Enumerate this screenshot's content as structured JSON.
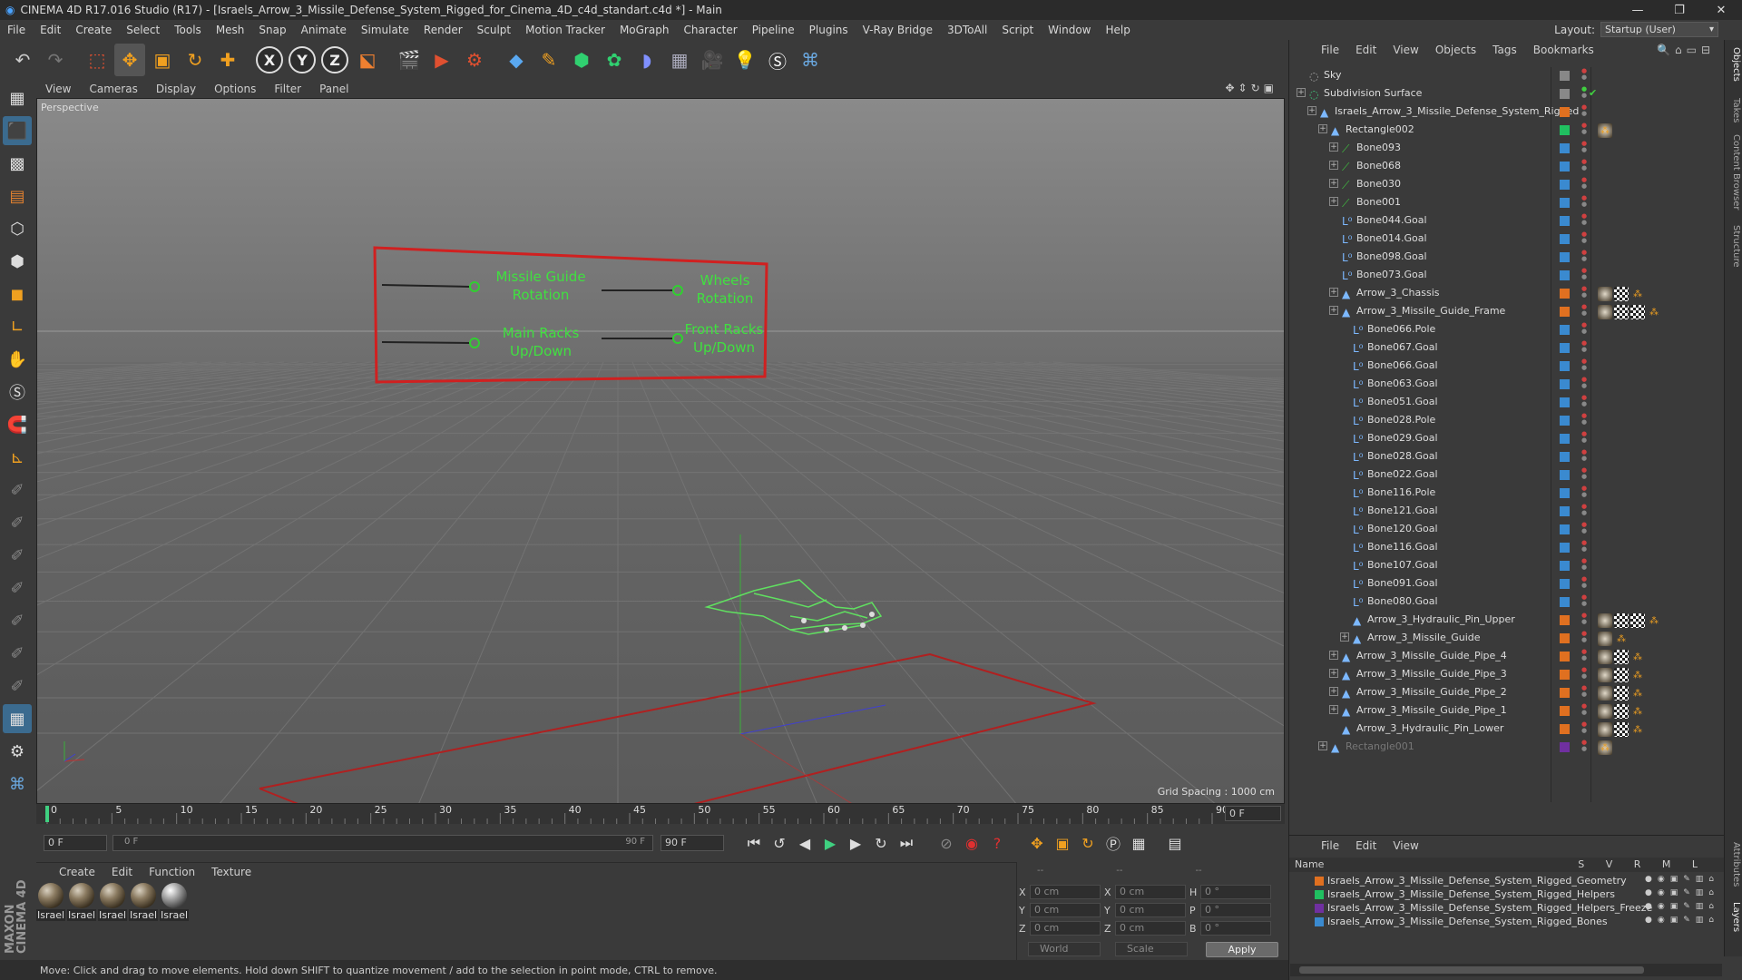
{
  "window": {
    "title": "CINEMA 4D R17.016 Studio (R17) - [Israels_Arrow_3_Missile_Defense_System_Rigged_for_Cinema_4D_c4d_standart.c4d *] - Main",
    "minimize": "—",
    "maximize": "❐",
    "close": "✕"
  },
  "menubar": {
    "items": [
      "File",
      "Edit",
      "Create",
      "Select",
      "Tools",
      "Mesh",
      "Snap",
      "Animate",
      "Simulate",
      "Render",
      "Sculpt",
      "Motion Tracker",
      "MoGraph",
      "Character",
      "Pipeline",
      "Plugins",
      "V-Ray Bridge",
      "3DToAll",
      "Script",
      "Window",
      "Help"
    ],
    "layout_label": "Layout:",
    "layout_value": "Startup (User)"
  },
  "toolbar": {
    "axis_x": "X",
    "axis_y": "Y",
    "axis_z": "Z"
  },
  "viewport": {
    "menu": [
      "View",
      "Cameras",
      "Display",
      "Options",
      "Filter",
      "Panel"
    ],
    "label": "Perspective",
    "grid_spacing": "Grid Spacing : 1000 cm",
    "controls": {
      "missile_guide_rotation": "Missile Guide Rotation",
      "wheels_rotation": "Wheels Rotation",
      "main_racks_updown": "Main Racks Up/Down",
      "front_racks_updown": "Front Racks Up/Down"
    }
  },
  "timeline": {
    "ticks": [
      "0",
      "5",
      "10",
      "15",
      "20",
      "25",
      "30",
      "35",
      "40",
      "45",
      "50",
      "55",
      "60",
      "65",
      "70",
      "75",
      "80",
      "85",
      "90"
    ],
    "current_frame": "0 F",
    "start_field": "0 F",
    "range_start": "0 F",
    "range_end": "90 F",
    "end_field": "90 F"
  },
  "materials": {
    "menu": [
      "Create",
      "Edit",
      "Function",
      "Texture"
    ],
    "items": [
      "Israel",
      "Israel",
      "Israel",
      "Israel",
      "Israel"
    ]
  },
  "coordinates": {
    "header": [
      "--",
      "--",
      "--"
    ],
    "rows": [
      {
        "a": "X",
        "av": "0 cm",
        "b": "X",
        "bv": "0 cm",
        "c": "H",
        "cv": "0 °"
      },
      {
        "a": "Y",
        "av": "0 cm",
        "b": "Y",
        "bv": "0 cm",
        "c": "P",
        "cv": "0 °"
      },
      {
        "a": "Z",
        "av": "0 cm",
        "b": "Z",
        "bv": "0 cm",
        "c": "B",
        "cv": "0 °"
      }
    ],
    "world": "World",
    "scale": "Scale",
    "apply": "Apply"
  },
  "status": {
    "text": "Move: Click and drag to move elements. Hold down SHIFT to quantize movement / add to the selection in point mode, CTRL to remove."
  },
  "objects": {
    "menu": [
      "File",
      "Edit",
      "View",
      "Objects",
      "Tags",
      "Bookmarks"
    ],
    "rows": [
      {
        "name": "Sky",
        "color": "#888888"
      },
      {
        "name": "Subdivision Surface",
        "color": "#888888"
      },
      {
        "name": "Israels_Arrow_3_Missile_Defense_System_Rigged",
        "color": "#e07020"
      },
      {
        "name": "Rectangle002",
        "color": "#20c060"
      },
      {
        "name": "Bone093",
        "color": "#3a8ad0"
      },
      {
        "name": "Bone068",
        "color": "#3a8ad0"
      },
      {
        "name": "Bone030",
        "color": "#3a8ad0"
      },
      {
        "name": "Bone001",
        "color": "#3a8ad0"
      },
      {
        "name": "Bone044.Goal",
        "color": "#3a8ad0"
      },
      {
        "name": "Bone014.Goal",
        "color": "#3a8ad0"
      },
      {
        "name": "Bone098.Goal",
        "color": "#3a8ad0"
      },
      {
        "name": "Bone073.Goal",
        "color": "#3a8ad0"
      },
      {
        "name": "Arrow_3_Chassis",
        "color": "#e07020"
      },
      {
        "name": "Arrow_3_Missile_Guide_Frame",
        "color": "#e07020"
      },
      {
        "name": "Bone066.Pole",
        "color": "#3a8ad0"
      },
      {
        "name": "Bone067.Goal",
        "color": "#3a8ad0"
      },
      {
        "name": "Bone066.Goal",
        "color": "#3a8ad0"
      },
      {
        "name": "Bone063.Goal",
        "color": "#3a8ad0"
      },
      {
        "name": "Bone051.Goal",
        "color": "#3a8ad0"
      },
      {
        "name": "Bone028.Pole",
        "color": "#3a8ad0"
      },
      {
        "name": "Bone029.Goal",
        "color": "#3a8ad0"
      },
      {
        "name": "Bone028.Goal",
        "color": "#3a8ad0"
      },
      {
        "name": "Bone022.Goal",
        "color": "#3a8ad0"
      },
      {
        "name": "Bone116.Pole",
        "color": "#3a8ad0"
      },
      {
        "name": "Bone121.Goal",
        "color": "#3a8ad0"
      },
      {
        "name": "Bone120.Goal",
        "color": "#3a8ad0"
      },
      {
        "name": "Bone116.Goal",
        "color": "#3a8ad0"
      },
      {
        "name": "Bone107.Goal",
        "color": "#3a8ad0"
      },
      {
        "name": "Bone091.Goal",
        "color": "#3a8ad0"
      },
      {
        "name": "Bone080.Goal",
        "color": "#3a8ad0"
      },
      {
        "name": "Arrow_3_Hydraulic_Pin_Upper",
        "color": "#e07020"
      },
      {
        "name": "Arrow_3_Missile_Guide",
        "color": "#e07020"
      },
      {
        "name": "Arrow_3_Missile_Guide_Pipe_4",
        "color": "#e07020"
      },
      {
        "name": "Arrow_3_Missile_Guide_Pipe_3",
        "color": "#e07020"
      },
      {
        "name": "Arrow_3_Missile_Guide_Pipe_2",
        "color": "#e07020"
      },
      {
        "name": "Arrow_3_Missile_Guide_Pipe_1",
        "color": "#e07020"
      },
      {
        "name": "Arrow_3_Hydraulic_Pin_Lower",
        "color": "#e07020"
      },
      {
        "name": "Rectangle001",
        "color": "#7030a0"
      }
    ]
  },
  "layers": {
    "menu": [
      "File",
      "Edit",
      "View"
    ],
    "header_name": "Name",
    "header_cols": "S V R M L",
    "rows": [
      {
        "name": "Israels_Arrow_3_Missile_Defense_System_Rigged_Geometry",
        "color": "#e07020"
      },
      {
        "name": "Israels_Arrow_3_Missile_Defense_System_Rigged_Helpers",
        "color": "#20c060"
      },
      {
        "name": "Israels_Arrow_3_Missile_Defense_System_Rigged_Helpers_Freeze",
        "color": "#7030a0"
      },
      {
        "name": "Israels_Arrow_3_Missile_Defense_System_Rigged_Bones",
        "color": "#3a8ad0"
      }
    ]
  },
  "side_tabs": [
    "Objects",
    "Takes",
    "Content Browser",
    "Structure",
    "Attributes",
    "Layers"
  ]
}
